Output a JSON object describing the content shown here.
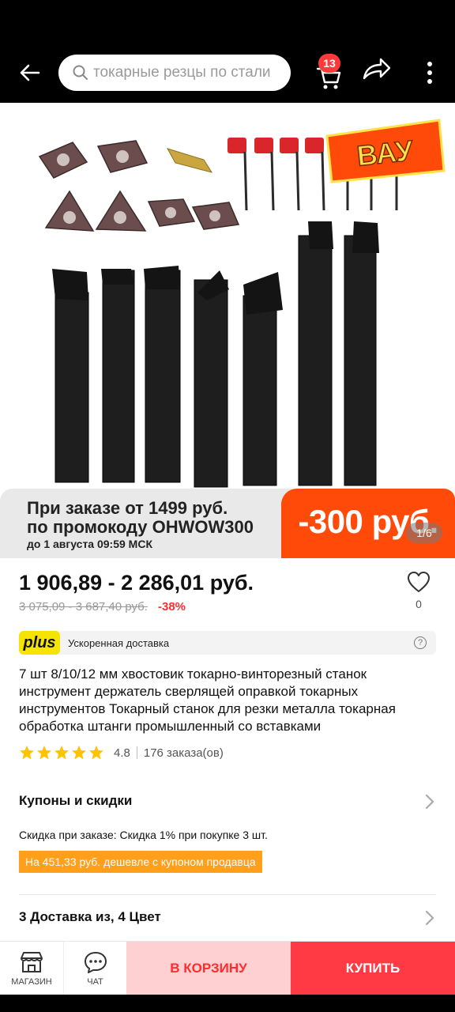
{
  "header": {
    "search_placeholder": "токарные резцы по стали",
    "cart_count": "13",
    "icons": [
      "back-arrow-icon",
      "search-icon",
      "cart-icon",
      "share-icon",
      "more-vertical-icon"
    ]
  },
  "gallery": {
    "badge_text": "ВАУ",
    "counter": "1/6",
    "promo": {
      "line1": "При заказе от 1499 руб.",
      "line2": "по промокоду OHWOW300",
      "line3": "до 1 августа 09:59 МСК",
      "amount": "-300 руб."
    }
  },
  "price": {
    "range": "1 906,89 - 2 286,01 руб.",
    "old_range": "3 075,09 - 3 687,40 руб.",
    "discount": "-38%",
    "favorites_count": "0"
  },
  "delivery_plus": {
    "logo_text": "plus",
    "text": "Ускоренная доставка",
    "info_icon": "?"
  },
  "product": {
    "title": "7 шт 8/10/12 мм хвостовик токарно-винторезный станок инструмент держатель сверлящей оправкой токарных инструментов Токарный станок для резки металла токарная обработка штанги промышленный со вставками",
    "rating": "4.8",
    "stars": 5,
    "orders": "176 заказа(ов)"
  },
  "coupons": {
    "title": "Купоны и скидки",
    "order_discount": "Скидка при заказе: Скидка 1% при покупке 3 шт.",
    "seller_coupon": "На 451,33 руб. дешевле с купоном продавца"
  },
  "delivery": {
    "title": "3 Доставка из, 4 Цвет"
  },
  "bottom_bar": {
    "shop_label": "МАГАЗИН",
    "chat_label": "ЧАТ",
    "add_to_cart": "В КОРЗИНУ",
    "buy": "КУПИТЬ"
  },
  "colors": {
    "accent_red": "#ff3a44",
    "promo_orange": "#ff4a0a",
    "coupon_orange": "#ff9f1a",
    "plus_yellow": "#f5e400",
    "star_yellow": "#ffc400"
  }
}
